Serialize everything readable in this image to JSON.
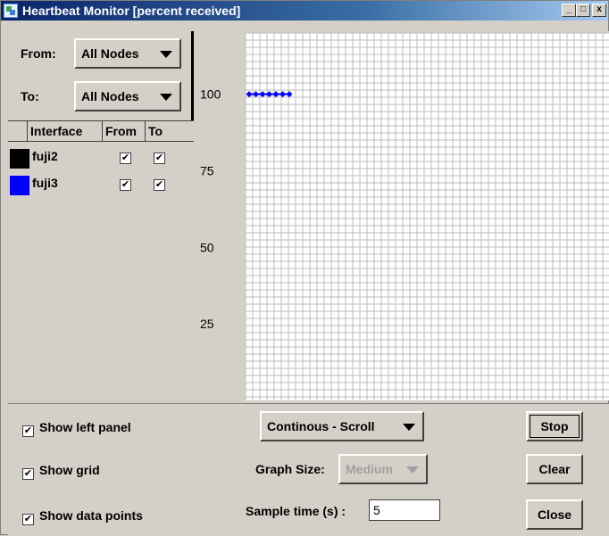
{
  "window": {
    "title": "Heartbeat Monitor [percent received]",
    "buttons": {
      "minimize": "_",
      "maximize": "□",
      "close": "x"
    }
  },
  "left_panel": {
    "from_label": "From:",
    "from_value": "All Nodes",
    "to_label": "To:",
    "to_value": "All Nodes",
    "table": {
      "headers": [
        "",
        "Interface",
        "From",
        "To"
      ],
      "rows": [
        {
          "color": "#000000",
          "name": "fuji2",
          "from": true,
          "to": true
        },
        {
          "color": "#0000ff",
          "name": "fuji3",
          "from": true,
          "to": true
        }
      ]
    }
  },
  "chart_data": {
    "type": "line",
    "title": "",
    "xlabel": "",
    "ylabel": "",
    "y_ticks": [
      "100",
      "75",
      "50",
      "25"
    ],
    "ylim": [
      0,
      120
    ],
    "grid": true,
    "series": [
      {
        "color": "#0000ff",
        "values": [
          100,
          100,
          100,
          100,
          100,
          100,
          100
        ]
      }
    ]
  },
  "bottom": {
    "show_left_panel": {
      "label": "Show left panel",
      "checked": true
    },
    "show_grid": {
      "label": "Show grid",
      "checked": true
    },
    "show_data_points": {
      "label": "Show data points",
      "checked": true
    },
    "mode_value": "Continous - Scroll",
    "graph_size_label": "Graph Size:",
    "graph_size_value": "Medium",
    "sample_time_label": "Sample time (s) :",
    "sample_time_value": "5",
    "stop_label": "Stop",
    "clear_label": "Clear",
    "close_label": "Close"
  }
}
